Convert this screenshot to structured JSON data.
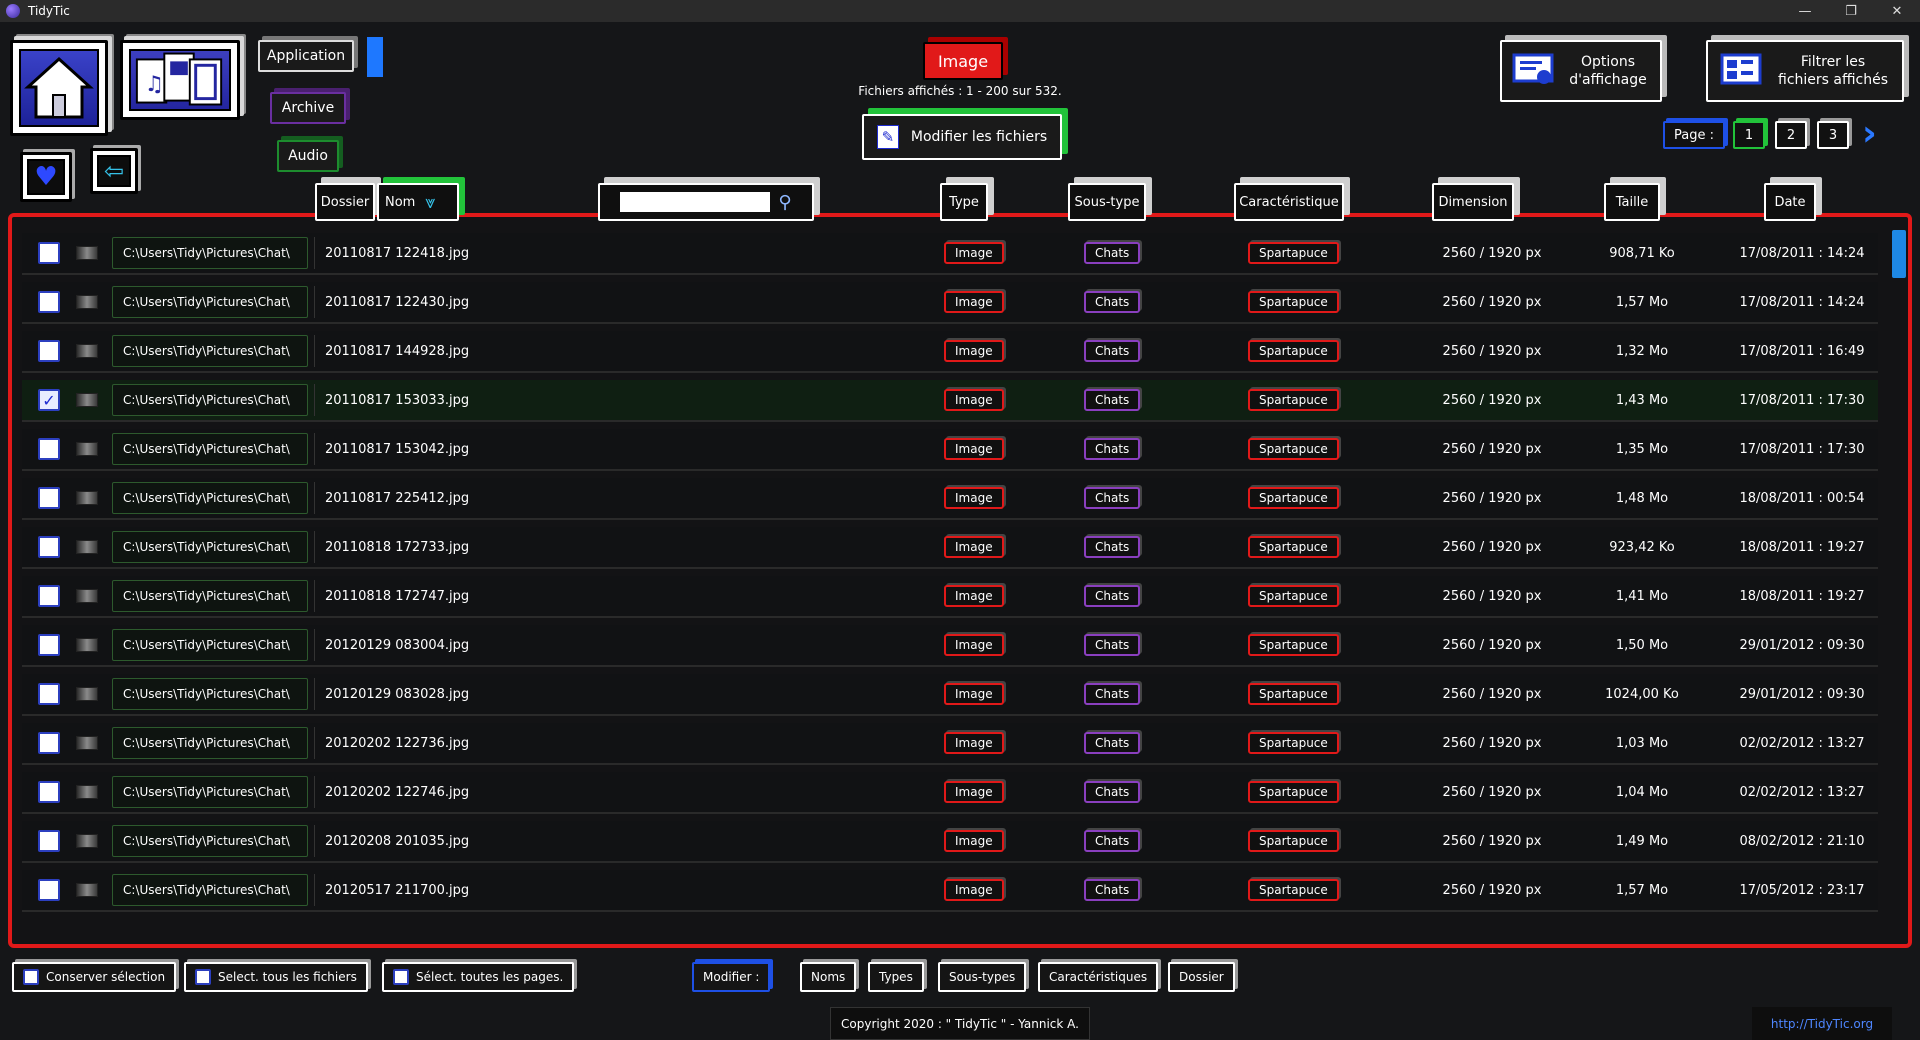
{
  "window": {
    "title": "TidyTic",
    "controls": [
      "—",
      "❐",
      "✕"
    ]
  },
  "top": {
    "categories": {
      "application": "Application",
      "archive": "Archive",
      "audio": "Audio"
    },
    "selected_type": "Image",
    "files_shown": "Fichiers affichés : 1 - 200 sur 532.",
    "modify_files": "Modifier les fichiers",
    "display_options": "Options d'affichage",
    "filter_files": "Filtrer les fichiers affichés",
    "page_label": "Page :",
    "pages": [
      "1",
      "2",
      "3"
    ]
  },
  "columns": {
    "folder": "Dossier",
    "name": "Nom",
    "type": "Type",
    "subtype": "Sous-type",
    "feature": "Caractéristique",
    "dimension": "Dimension",
    "size": "Taille",
    "date": "Date",
    "search_placeholder": ""
  },
  "rows": [
    {
      "checked": false,
      "folder": "C:\\Users\\Tidy\\Pictures\\Chat\\",
      "name": "20110817 122418.jpg",
      "type": "Image",
      "subtype": "Chats",
      "feature": "Spartapuce",
      "dimension": "2560 / 1920 px",
      "size": "908,71 Ko",
      "date": "17/08/2011 : 14:24"
    },
    {
      "checked": false,
      "folder": "C:\\Users\\Tidy\\Pictures\\Chat\\",
      "name": "20110817 122430.jpg",
      "type": "Image",
      "subtype": "Chats",
      "feature": "Spartapuce",
      "dimension": "2560 / 1920 px",
      "size": "1,57 Mo",
      "date": "17/08/2011 : 14:24"
    },
    {
      "checked": false,
      "folder": "C:\\Users\\Tidy\\Pictures\\Chat\\",
      "name": "20110817 144928.jpg",
      "type": "Image",
      "subtype": "Chats",
      "feature": "Spartapuce",
      "dimension": "2560 / 1920 px",
      "size": "1,32 Mo",
      "date": "17/08/2011 : 16:49"
    },
    {
      "checked": true,
      "folder": "C:\\Users\\Tidy\\Pictures\\Chat\\",
      "name": "20110817 153033.jpg",
      "type": "Image",
      "subtype": "Chats",
      "feature": "Spartapuce",
      "dimension": "2560 / 1920 px",
      "size": "1,43 Mo",
      "date": "17/08/2011 : 17:30"
    },
    {
      "checked": false,
      "folder": "C:\\Users\\Tidy\\Pictures\\Chat\\",
      "name": "20110817 153042.jpg",
      "type": "Image",
      "subtype": "Chats",
      "feature": "Spartapuce",
      "dimension": "2560 / 1920 px",
      "size": "1,35 Mo",
      "date": "17/08/2011 : 17:30"
    },
    {
      "checked": false,
      "folder": "C:\\Users\\Tidy\\Pictures\\Chat\\",
      "name": "20110817 225412.jpg",
      "type": "Image",
      "subtype": "Chats",
      "feature": "Spartapuce",
      "dimension": "2560 / 1920 px",
      "size": "1,48 Mo",
      "date": "18/08/2011 : 00:54"
    },
    {
      "checked": false,
      "folder": "C:\\Users\\Tidy\\Pictures\\Chat\\",
      "name": "20110818 172733.jpg",
      "type": "Image",
      "subtype": "Chats",
      "feature": "Spartapuce",
      "dimension": "2560 / 1920 px",
      "size": "923,42 Ko",
      "date": "18/08/2011 : 19:27"
    },
    {
      "checked": false,
      "folder": "C:\\Users\\Tidy\\Pictures\\Chat\\",
      "name": "20110818 172747.jpg",
      "type": "Image",
      "subtype": "Chats",
      "feature": "Spartapuce",
      "dimension": "2560 / 1920 px",
      "size": "1,41 Mo",
      "date": "18/08/2011 : 19:27"
    },
    {
      "checked": false,
      "folder": "C:\\Users\\Tidy\\Pictures\\Chat\\",
      "name": "20120129 083004.jpg",
      "type": "Image",
      "subtype": "Chats",
      "feature": "Spartapuce",
      "dimension": "2560 / 1920 px",
      "size": "1,50 Mo",
      "date": "29/01/2012 : 09:30"
    },
    {
      "checked": false,
      "folder": "C:\\Users\\Tidy\\Pictures\\Chat\\",
      "name": "20120129 083028.jpg",
      "type": "Image",
      "subtype": "Chats",
      "feature": "Spartapuce",
      "dimension": "2560 / 1920 px",
      "size": "1024,00 Ko",
      "date": "29/01/2012 : 09:30"
    },
    {
      "checked": false,
      "folder": "C:\\Users\\Tidy\\Pictures\\Chat\\",
      "name": "20120202 122736.jpg",
      "type": "Image",
      "subtype": "Chats",
      "feature": "Spartapuce",
      "dimension": "2560 / 1920 px",
      "size": "1,03 Mo",
      "date": "02/02/2012 : 13:27"
    },
    {
      "checked": false,
      "folder": "C:\\Users\\Tidy\\Pictures\\Chat\\",
      "name": "20120202 122746.jpg",
      "type": "Image",
      "subtype": "Chats",
      "feature": "Spartapuce",
      "dimension": "2560 / 1920 px",
      "size": "1,04 Mo",
      "date": "02/02/2012 : 13:27"
    },
    {
      "checked": false,
      "folder": "C:\\Users\\Tidy\\Pictures\\Chat\\",
      "name": "20120208 201035.jpg",
      "type": "Image",
      "subtype": "Chats",
      "feature": "Spartapuce",
      "dimension": "2560 / 1920 px",
      "size": "1,49 Mo",
      "date": "08/02/2012 : 21:10"
    },
    {
      "checked": false,
      "folder": "C:\\Users\\Tidy\\Pictures\\Chat\\",
      "name": "20120517 211700.jpg",
      "type": "Image",
      "subtype": "Chats",
      "feature": "Spartapuce",
      "dimension": "2560 / 1920 px",
      "size": "1,57 Mo",
      "date": "17/05/2012 : 23:17"
    }
  ],
  "bottom": {
    "keep_selection": "Conserver sélection",
    "select_all_files": "Select. tous les fichiers",
    "select_all_pages": "Sélect. toutes les pages.",
    "modify_label": "Modifier :",
    "names": "Noms",
    "types": "Types",
    "subtypes": "Sous-types",
    "features": "Caractéristiques",
    "folder": "Dossier"
  },
  "footer": {
    "copyright": "Copyright 2020 : \" TidyTic \" - Yannick A.",
    "url": "http://TidyTic.org"
  },
  "colors": {
    "accent_red": "#e11919",
    "accent_green": "#22c33a",
    "accent_blue": "#1e50e5",
    "purple": "#8a3fbf"
  },
  "icons": [
    "home-icon",
    "media-files-icon",
    "heart-icon",
    "back-arrow-icon",
    "search-icon",
    "edit-icon",
    "display-options-icon",
    "filter-icon",
    "chevron-right-icon",
    "checkbox-icon"
  ]
}
